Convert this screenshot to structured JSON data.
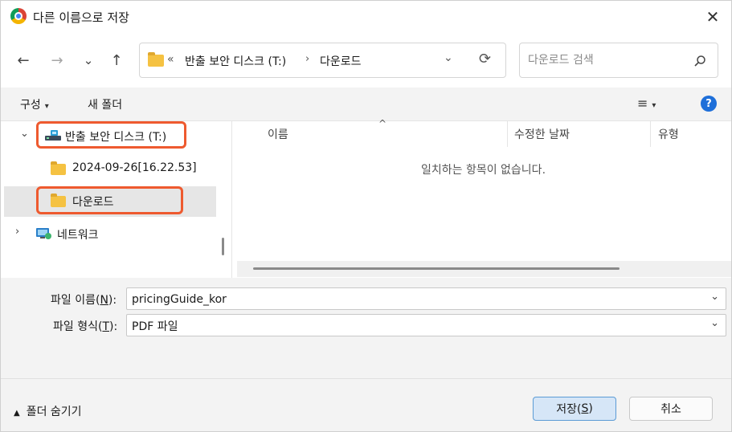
{
  "window": {
    "title": "다른 이름으로 저장",
    "close": "✕"
  },
  "nav": {
    "back": "←",
    "forward": "→",
    "recent": "⌄",
    "up": "↑"
  },
  "address": {
    "overflow": "«",
    "path": [
      "반출 보안 디스크 (T:)",
      "다운로드"
    ],
    "separator": "›",
    "dropdown": "⌄",
    "refresh": "⟳"
  },
  "search": {
    "placeholder": "다운로드 검색"
  },
  "toolbar": {
    "organize": "구성",
    "new_folder": "새 폴더",
    "caret": "▾",
    "view": "≡",
    "help": "?"
  },
  "tree": {
    "items": [
      {
        "label": "반출 보안 디스크 (T:)",
        "chevron": "⌄"
      },
      {
        "label": "2024-09-26[16.22.53]"
      },
      {
        "label": "다운로드"
      },
      {
        "label": "네트워크",
        "chevron": "›"
      }
    ]
  },
  "file_list": {
    "columns": [
      "이름",
      "수정한 날짜",
      "유형"
    ],
    "sort_indicator": "^",
    "empty_message": "일치하는 항목이 없습니다."
  },
  "form": {
    "filename_label_pre": "파일 이름(",
    "filename_label_key": "N",
    "filename_label_post": "):",
    "filename_value": "pricingGuide_kor",
    "filetype_label_pre": "파일 형식(",
    "filetype_label_key": "T",
    "filetype_label_post": "):",
    "filetype_value": "PDF 파일",
    "dropdown": "⌄"
  },
  "footer": {
    "hide_folders_icon": "▲",
    "hide_folders": "폴더 숨기기",
    "save_pre": "저장(",
    "save_key": "S",
    "save_post": ")",
    "cancel": "취소"
  },
  "colors": {
    "highlight": "#ee5a2f",
    "accent": "#1e6fd9",
    "folder": "#f5c242"
  }
}
